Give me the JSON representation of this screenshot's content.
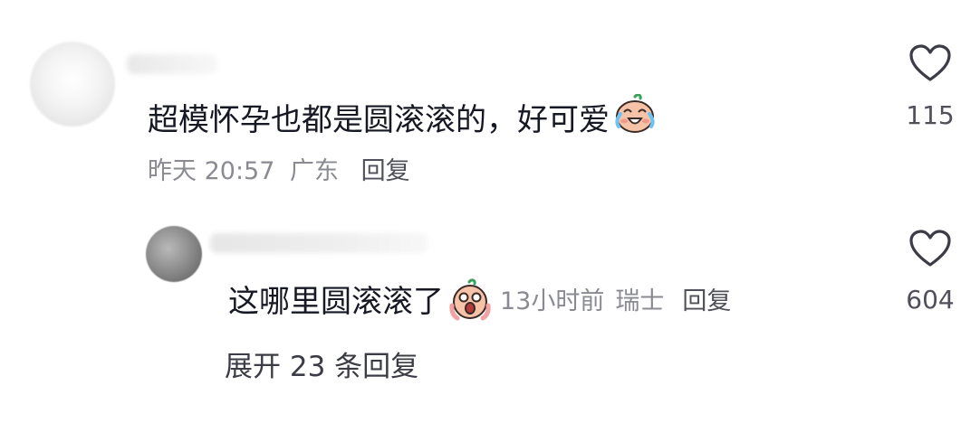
{
  "comments": [
    {
      "text": "超模怀孕也都是圆滚滚的，好可爱",
      "emoji": "crying-laughing-emoji",
      "time": "昨天 20:57",
      "location": "广东",
      "reply_label": "回复",
      "like_icon": "heart-outline-icon",
      "likes": "115"
    }
  ],
  "reply": {
    "text": "这哪里圆滚滚了",
    "emoji": "screaming-emoji",
    "time": "13小时前",
    "location": "瑞士",
    "reply_label": "回复",
    "like_icon": "heart-outline-icon",
    "likes": "604"
  },
  "expand_label": "展开 23 条回复",
  "colors": {
    "primary_text": "#161823",
    "secondary_text": "#8a8b91",
    "action_text": "#4f5059"
  }
}
